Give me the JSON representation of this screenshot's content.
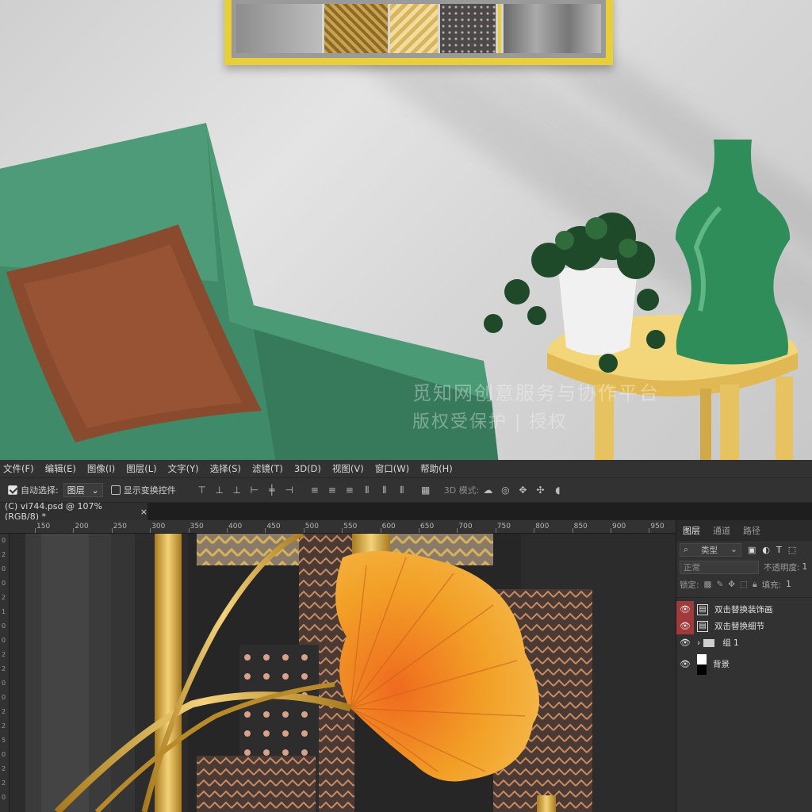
{
  "watermark": {
    "line1": "觅知网创意服务与协作平台",
    "line2": "版权受保护 | 授权"
  },
  "menu": [
    "文件(F)",
    "编辑(E)",
    "图像(I)",
    "图层(L)",
    "文字(Y)",
    "选择(S)",
    "滤镜(T)",
    "3D(D)",
    "视图(V)",
    "窗口(W)",
    "帮助(H)"
  ],
  "options": {
    "auto_select_label": "自动选择:",
    "auto_select_value": "图层",
    "show_transform_label": "显示变换控件",
    "mode_3d_label": "3D 模式:"
  },
  "document_tab": {
    "title": "(C) vi744.psd @ 107%(RGB/8) *",
    "close": "×"
  },
  "ruler_ticks": [
    "150",
    "200",
    "250",
    "300",
    "350",
    "400",
    "450",
    "500",
    "550",
    "600",
    "650",
    "700",
    "750",
    "800",
    "850",
    "900",
    "950"
  ],
  "vertical_ruler": [
    "0",
    "2",
    "0",
    "0",
    "2",
    "1",
    "0",
    "0",
    "2",
    "2",
    "0",
    "0",
    "2",
    "2",
    "5",
    "0",
    "2",
    "2",
    "0"
  ],
  "layers_panel": {
    "tabs": [
      "图层",
      "通道",
      "路径"
    ],
    "filter_label": "类型",
    "blend_mode": "正常",
    "opacity_label": "不透明度:",
    "opacity_value": "1",
    "lock_label": "锁定:",
    "fill_label": "填充:",
    "fill_value": "1",
    "layers": [
      {
        "name": "双击替换装饰画",
        "type": "smart",
        "highlight": true
      },
      {
        "name": "双击替换细节",
        "type": "smart",
        "highlight": true
      },
      {
        "name": "组 1",
        "type": "group",
        "highlight": false
      },
      {
        "name": "背景",
        "type": "background",
        "highlight": false
      }
    ]
  },
  "colors": {
    "chair": "#3f8a68",
    "pillow": "#8a4a2e",
    "table": "#f1cd6a",
    "vase": "#2f8d5a",
    "frame": "#e8cf3a",
    "ginkgo": "#f2a127",
    "gold": "#d9a93c",
    "eye_highlight": "#a13a3a"
  }
}
